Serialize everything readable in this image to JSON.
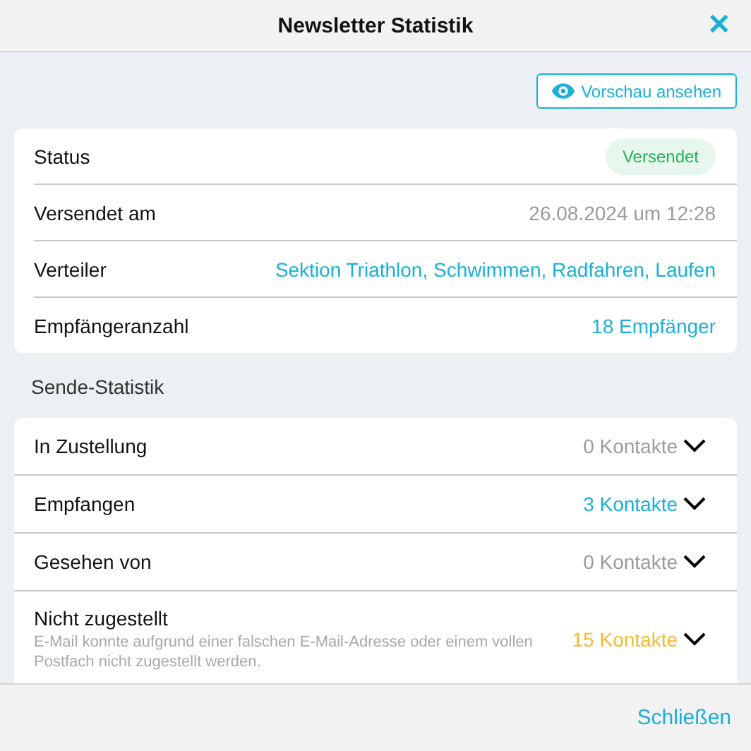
{
  "window": {
    "title": "Newsletter Statistik",
    "close": "✕"
  },
  "preview_button": {
    "label": "Vorschau ansehen"
  },
  "details": [
    {
      "label": "Status",
      "value": "Versendet",
      "kind": "badge"
    },
    {
      "label": "Versendet am",
      "value": "26.08.2024 um 12:28",
      "kind": "muted"
    },
    {
      "label": "Verteiler",
      "value": "Sektion Triathlon, Schwimmen, Radfahren, Laufen",
      "kind": "link"
    },
    {
      "label": "Empfängeranzahl",
      "value": "18 Empfänger",
      "kind": "link"
    }
  ],
  "section_title": "Sende-Statistik",
  "stats": [
    {
      "label": "In Zustellung",
      "value": "0 Kontakte",
      "color": "#9a9a9f",
      "expanded": false
    },
    {
      "label": "Empfangen",
      "value": "3 Kontakte",
      "color": "#1ab0d8",
      "expanded": false
    },
    {
      "label": "Gesehen von",
      "value": "0 Kontakte",
      "color": "#9a9a9f",
      "expanded": false
    },
    {
      "label": "Nicht zugestellt",
      "description": "E-Mail konnte aufgrund einer falschen E-Mail-Adresse oder einem vollen Postfach nicht zugestellt werden.",
      "value": "15 Kontakte",
      "color": "#f5bb2c",
      "expanded": false
    }
  ],
  "footer": {
    "button": "Schließen"
  }
}
